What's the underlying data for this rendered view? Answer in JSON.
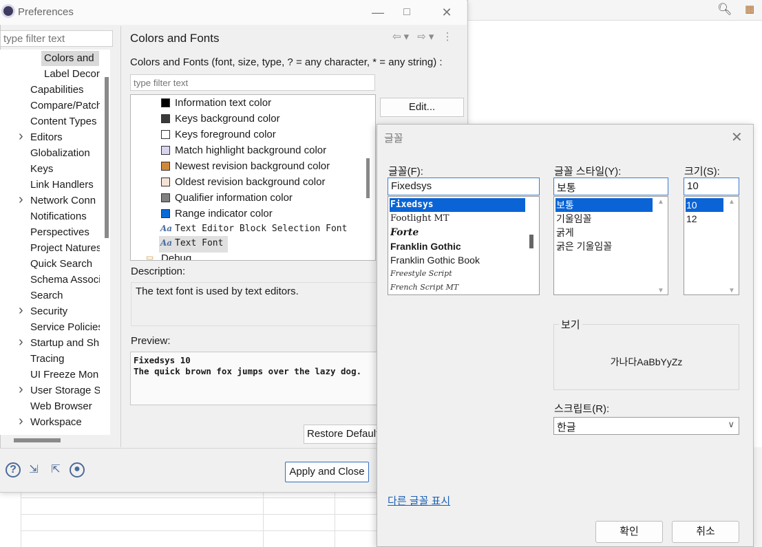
{
  "prefs": {
    "title": "Preferences",
    "tree_filter_placeholder": "type filter text",
    "tree": [
      {
        "label": "Colors and",
        "arrow": false,
        "indent": "child"
      },
      {
        "label": "Label Decor",
        "arrow": false,
        "indent": "child"
      },
      {
        "label": "Capabilities",
        "arrow": false
      },
      {
        "label": "Compare/Patch",
        "arrow": false
      },
      {
        "label": "Content Types",
        "arrow": false
      },
      {
        "label": "Editors",
        "arrow": true
      },
      {
        "label": "Globalization",
        "arrow": false
      },
      {
        "label": "Keys",
        "arrow": false
      },
      {
        "label": "Link Handlers",
        "arrow": false
      },
      {
        "label": "Network Conn",
        "arrow": true
      },
      {
        "label": "Notifications",
        "arrow": false
      },
      {
        "label": "Perspectives",
        "arrow": false
      },
      {
        "label": "Project Natures",
        "arrow": false
      },
      {
        "label": "Quick Search",
        "arrow": false
      },
      {
        "label": "Schema Associ",
        "arrow": false
      },
      {
        "label": "Search",
        "arrow": false
      },
      {
        "label": "Security",
        "arrow": true
      },
      {
        "label": "Service Policies",
        "arrow": false
      },
      {
        "label": "Startup and Sh",
        "arrow": true
      },
      {
        "label": "Tracing",
        "arrow": false
      },
      {
        "label": "UI Freeze Mon",
        "arrow": false
      },
      {
        "label": "User Storage S",
        "arrow": true
      },
      {
        "label": "Web Browser",
        "arrow": false
      },
      {
        "label": "Workspace",
        "arrow": true
      }
    ],
    "page_title": "Colors and Fonts",
    "subtitle": "Colors and Fonts (font, size, type, ? = any character, * = any string) :",
    "cf_filter_placeholder": "type filter text",
    "edit_label": "Edit...",
    "cf_items": [
      {
        "label": "Information text color",
        "kind": "color",
        "color": "#000000"
      },
      {
        "label": "Keys background color",
        "kind": "color",
        "color": "#3a3a3a"
      },
      {
        "label": "Keys foreground color",
        "kind": "color",
        "color": "#ffffff"
      },
      {
        "label": "Match highlight background color",
        "kind": "color",
        "color": "#d8d4f0"
      },
      {
        "label": "Newest revision background color",
        "kind": "color",
        "color": "#d0893c"
      },
      {
        "label": "Oldest revision background color",
        "kind": "color",
        "color": "#f6e2d4"
      },
      {
        "label": "Qualifier information color",
        "kind": "color",
        "color": "#808080"
      },
      {
        "label": "Range indicator color",
        "kind": "color",
        "color": "#0a6ad6"
      },
      {
        "label": "Text Editor Block Selection Font",
        "kind": "font"
      },
      {
        "label": "Text Font",
        "kind": "font"
      },
      {
        "label": "Debug",
        "kind": "folder"
      }
    ],
    "description_label": "Description:",
    "description_text": "The text font is used by text editors.",
    "preview_label": "Preview:",
    "preview_text": "Fixedsys 10\nThe quick brown fox jumps over the lazy dog.",
    "restore_label": "Restore Defaults",
    "apply_close_label": "Apply and Close"
  },
  "font_dialog": {
    "title": "글꼴",
    "font_label": "글꼴(F):",
    "font_value": "Fixedsys",
    "fonts": [
      "Fixedsys",
      "Footlight MT",
      "Forte",
      "Franklin Gothic",
      "Franklin Gothic Book",
      "Freestyle Script",
      "French Script MT"
    ],
    "style_label": "글꼴 스타일(Y):",
    "style_value": "보통",
    "styles": [
      "보통",
      "기울임꼴",
      "굵게",
      "굵은 기울임꼴"
    ],
    "size_label": "크기(S):",
    "size_value": "10",
    "sizes": [
      "10",
      "12"
    ],
    "sample_label": "보기",
    "sample_text": "가나다AaBbYyZz",
    "script_label": "스크립트(R):",
    "script_value": "한글",
    "more_fonts_link": "다른 글꼴 표시",
    "ok_label": "확인",
    "cancel_label": "취소"
  },
  "colors": {
    "selection_blue": "#0a64d6",
    "link_blue": "#1a5fb4"
  }
}
